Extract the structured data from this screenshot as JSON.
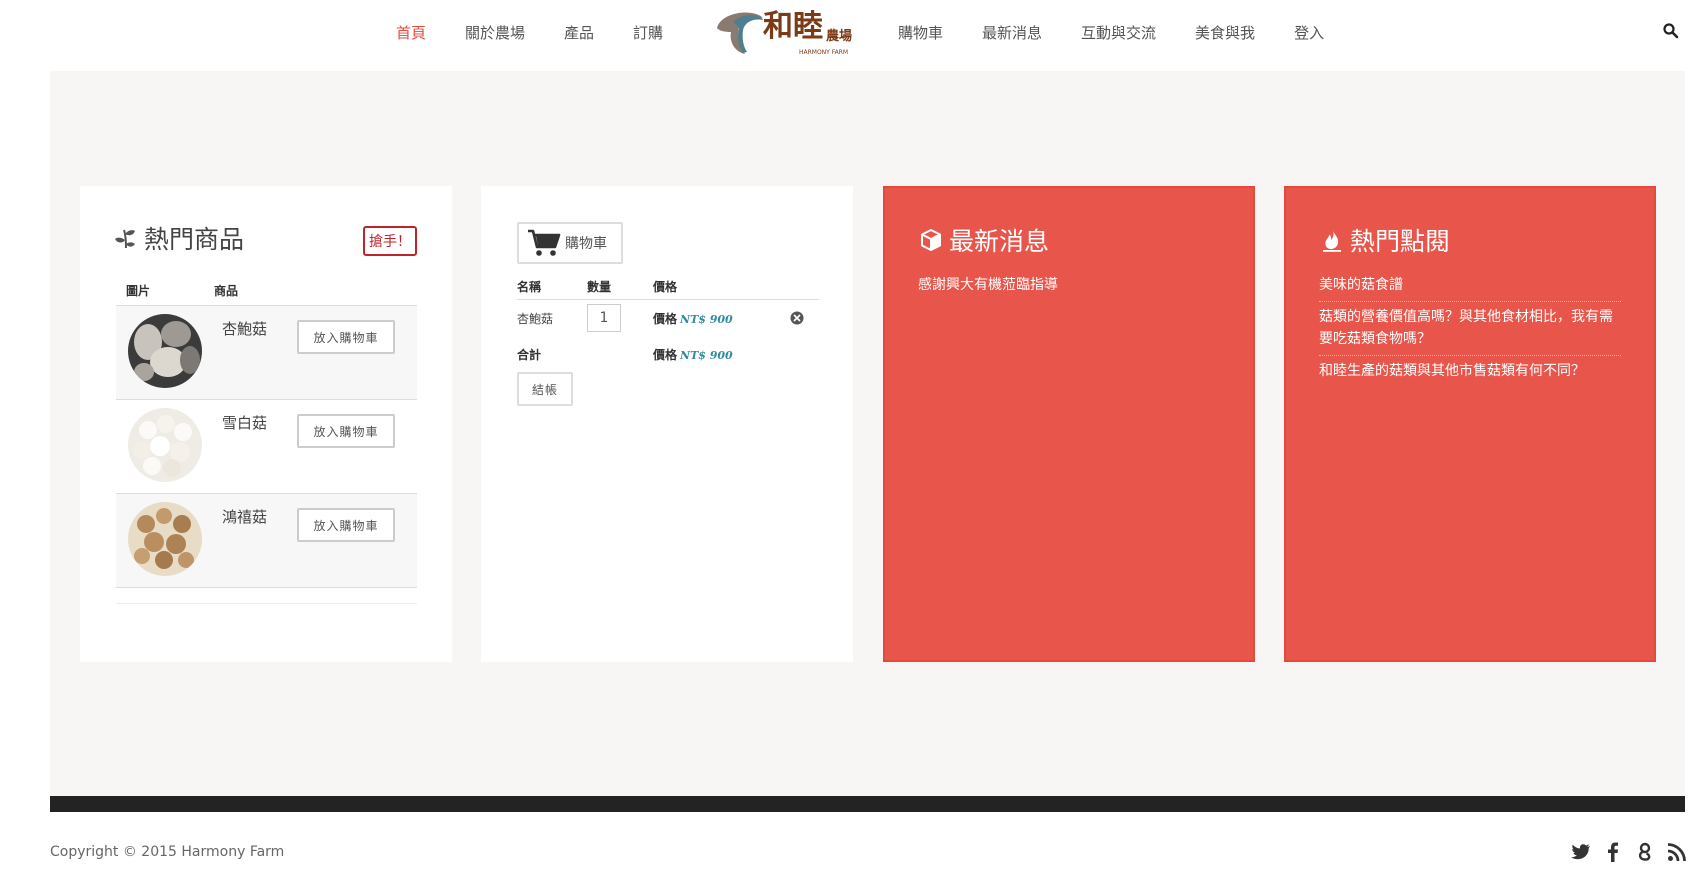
{
  "nav": {
    "left": [
      "首頁",
      "關於農場",
      "產品",
      "訂購"
    ],
    "right": [
      "購物車",
      "最新消息",
      "互動與交流",
      "美食與我",
      "登入"
    ]
  },
  "logo": {
    "text": "和睦",
    "sub": "農場",
    "en": "HARMONY FARM"
  },
  "hot_products": {
    "title": "熱門商品",
    "badge": "搶手！",
    "col_image": "圖片",
    "col_product": "商品",
    "add_label": "放入購物車",
    "items": [
      {
        "name": "杏鮑菇"
      },
      {
        "name": "雪白菇"
      },
      {
        "name": "鴻禧菇"
      }
    ]
  },
  "cart": {
    "button": "購物車",
    "col_name": "名稱",
    "col_qty": "數量",
    "col_price": "價格",
    "item_name": "杏鮑菇",
    "item_qty": "1",
    "price_label": "價格",
    "item_price": "NT$ 900",
    "total_label": "合計",
    "total_price": "NT$ 900",
    "checkout": "結帳"
  },
  "news": {
    "title": "最新消息",
    "items": [
      "感謝興大有機蒞臨指導"
    ]
  },
  "hot_reads": {
    "title": "熱門點閱",
    "items": [
      "美味的菇食譜",
      "菇類的營養價值高嗎？與其他食材相比，我有需要吃菇類食物嗎？",
      "和睦生產的菇類與其他市售菇類有何不同？"
    ]
  },
  "footer": {
    "copyright": "Copyright © 2015 Harmony Farm"
  },
  "colors": {
    "accent": "#e8554b",
    "nav_active": "#e04d3f",
    "price": "#2f8aa3",
    "badge": "#c0232c"
  }
}
